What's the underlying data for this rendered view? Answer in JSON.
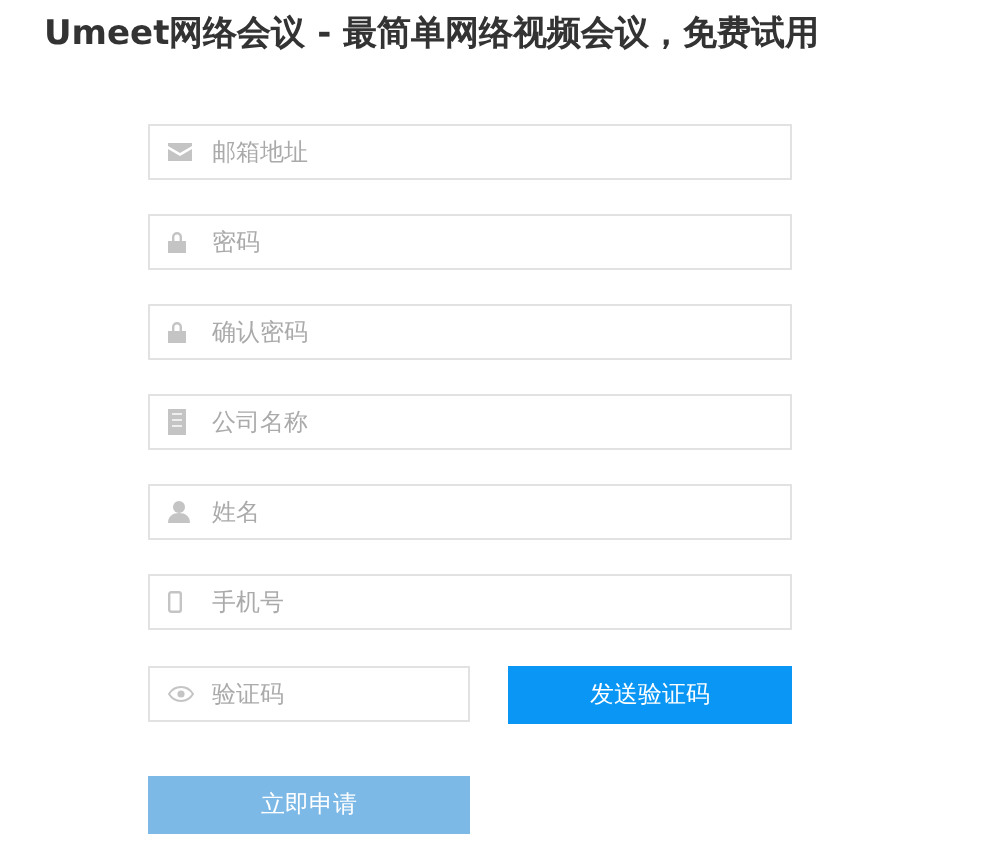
{
  "title": "Umeet网络会议 - 最简单网络视频会议，免费试用",
  "fields": [
    {
      "kind": "email",
      "placeholder": "邮箱地址"
    },
    {
      "kind": "password",
      "placeholder": "密码"
    },
    {
      "kind": "password",
      "placeholder": "确认密码"
    },
    {
      "kind": "company",
      "placeholder": "公司名称"
    },
    {
      "kind": "person",
      "placeholder": "姓名"
    },
    {
      "kind": "phone",
      "placeholder": "手机号"
    }
  ],
  "code_field": {
    "placeholder": "验证码"
  },
  "send_code_button": "发送验证码",
  "submit_button": {
    "label": "立即申请",
    "disabled": true
  }
}
